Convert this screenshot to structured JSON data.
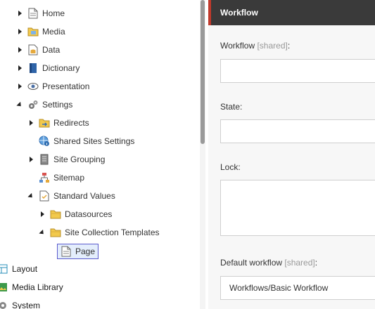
{
  "tree": {
    "items": [
      {
        "label": "Home",
        "icon": "home-page-icon"
      },
      {
        "label": "Media",
        "icon": "media-folder-icon"
      },
      {
        "label": "Data",
        "icon": "data-icon"
      },
      {
        "label": "Dictionary",
        "icon": "dictionary-book-icon"
      },
      {
        "label": "Presentation",
        "icon": "eye-icon"
      },
      {
        "label": "Settings",
        "icon": "gears-icon"
      },
      {
        "label": "Redirects",
        "icon": "redirect-folder-icon"
      },
      {
        "label": "Shared Sites Settings",
        "icon": "globe-info-icon"
      },
      {
        "label": "Site Grouping",
        "icon": "server-stack-icon"
      },
      {
        "label": "Sitemap",
        "icon": "sitemap-icon"
      },
      {
        "label": "Standard Values",
        "icon": "standard-values-icon"
      },
      {
        "label": "Datasources",
        "icon": "folder-icon"
      },
      {
        "label": "Site Collection Templates",
        "icon": "folder-icon"
      },
      {
        "label": "Page",
        "icon": "page-document-icon"
      },
      {
        "label": "Layout",
        "icon": "layout-icon"
      },
      {
        "label": "Media Library",
        "icon": "media-library-icon"
      },
      {
        "label": "System",
        "icon": "system-icon"
      }
    ]
  },
  "section": {
    "title": "Workflow",
    "accent": "#c0392b"
  },
  "fields": {
    "workflow": {
      "label": "Workflow",
      "shared": "[shared]",
      "suffix": ":",
      "value": ""
    },
    "state": {
      "label": "State:",
      "value": ""
    },
    "lock": {
      "label": "Lock:",
      "value": ""
    },
    "default_workflow": {
      "label": "Default workflow",
      "shared": "[shared]",
      "suffix": ":",
      "value": "Workflows/Basic Workflow"
    }
  }
}
